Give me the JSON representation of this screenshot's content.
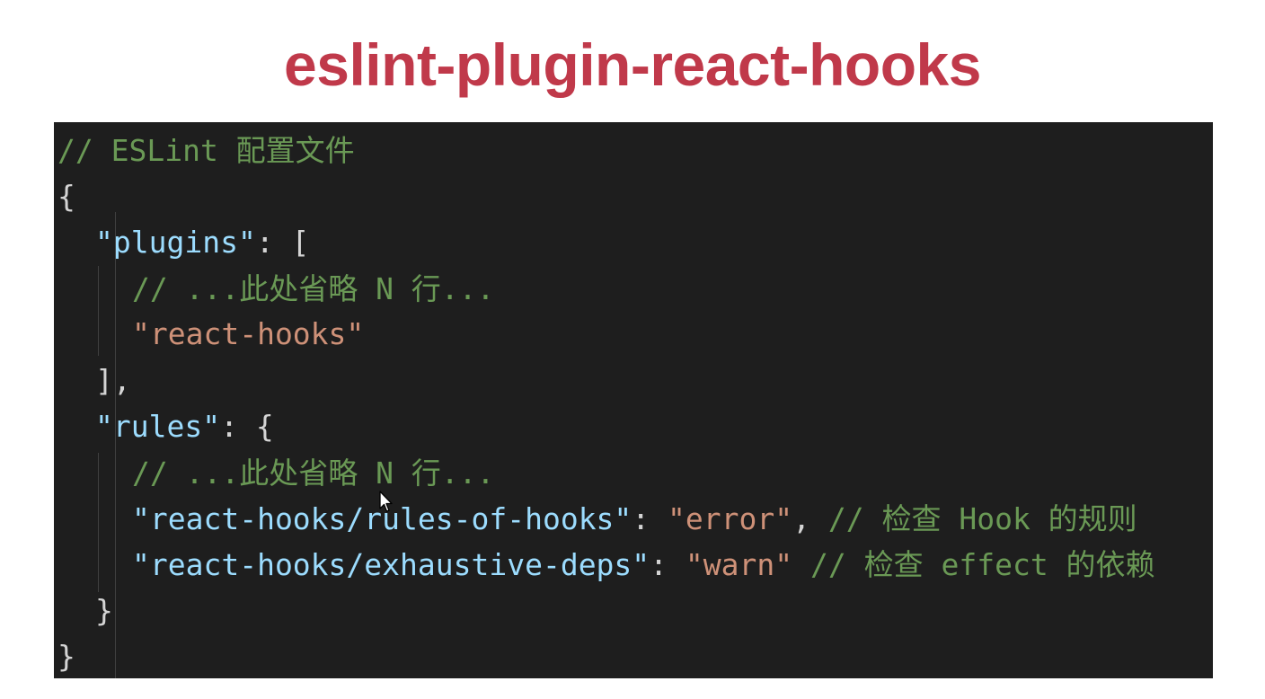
{
  "title": "eslint-plugin-react-hooks",
  "code": {
    "line1": {
      "comment": "// ESLint 配置文件"
    },
    "line2": {
      "open": "{"
    },
    "line3": {
      "key": "\"plugins\"",
      "punc": ": ["
    },
    "line4": {
      "comment": "// ...此处省略 N 行..."
    },
    "line5": {
      "str": "\"react-hooks\""
    },
    "line6": {
      "punc": "],"
    },
    "line7": {
      "key": "\"rules\"",
      "punc": ": {"
    },
    "line8": {
      "comment": "// ...此处省略 N 行..."
    },
    "line9": {
      "key": "\"react-hooks/rules-of-hooks\"",
      "colon": ": ",
      "str": "\"error\"",
      "comma": ", ",
      "comment": "// 检查 Hook 的规则"
    },
    "line10": {
      "key": "\"react-hooks/exhaustive-deps\"",
      "colon": ": ",
      "str": "\"warn\"",
      "space": " ",
      "comment": "// 检查 effect 的依赖"
    },
    "line11": {
      "punc": "}"
    },
    "line12": {
      "close": "}"
    }
  },
  "colors": {
    "title": "#c0394a",
    "background": "#1e1e1e",
    "comment": "#6a9955",
    "key": "#9cdcfe",
    "string": "#ce9178",
    "punctuation": "#d4d4d4"
  },
  "icons": {
    "cursor": "mouse-pointer-icon"
  }
}
